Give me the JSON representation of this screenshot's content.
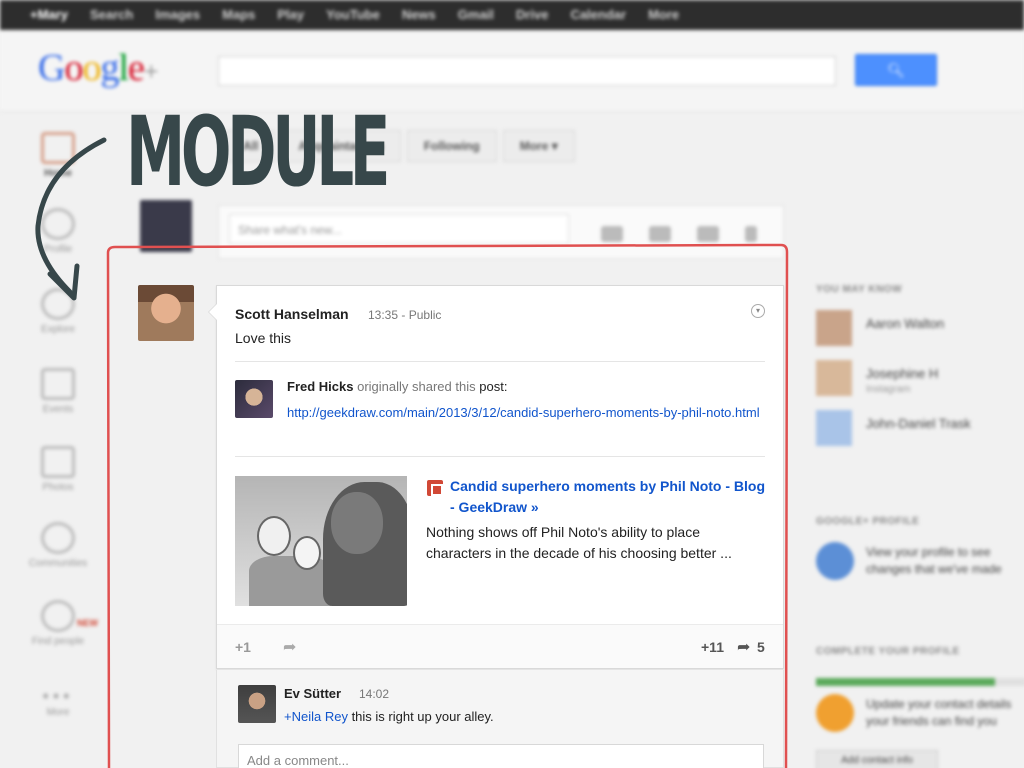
{
  "topbar": {
    "items": [
      "+Mary",
      "Search",
      "Images",
      "Maps",
      "Play",
      "YouTube",
      "News",
      "Gmail",
      "Drive",
      "Calendar",
      "More"
    ]
  },
  "header": {
    "logo_text": "Google",
    "logo_plus": "+",
    "search_icon": "search-icon"
  },
  "leftnav": {
    "items": [
      "Home",
      "Profile",
      "Explore",
      "Events",
      "Photos",
      "Communities",
      "Find people",
      "More"
    ],
    "new_tag": "NEW"
  },
  "filterbar": {
    "items": [
      "All",
      "Acquaintances",
      "Following",
      "More ▾"
    ]
  },
  "share": {
    "placeholder": "Share what's new..."
  },
  "post": {
    "author": "Scott Hanselman",
    "time": "13:35",
    "separator": "-",
    "visibility": "Public",
    "text": "Love this",
    "original_author": "Fred Hicks",
    "originally_shared": "originally shared this",
    "post_word": "post:",
    "link_url": "http://geekdraw.com/main/2013/3/12/candid-superhero-moments-by-phil-noto.html",
    "link_title": "Candid superhero moments by Phil Noto - Blog - GeekDraw »",
    "link_description": "Nothing shows off Phil Noto's ability to place characters in the decade of his choosing better ...",
    "plus_one": "+1",
    "plus_count": "+11",
    "share_count": "5"
  },
  "comment": {
    "author": "Ev Sütter",
    "time": "14:02",
    "mention": "+Neila Rey",
    "text": " this is right up your alley.",
    "input_placeholder": "Add a comment..."
  },
  "rightcol": {
    "you_may_know_heading": "YOU MAY KNOW",
    "people": [
      {
        "name": "Aaron Walton",
        "sub": ""
      },
      {
        "name": "Josephine H",
        "sub": "Instagram"
      },
      {
        "name": "John-Daniel Trask",
        "sub": ""
      }
    ],
    "profile_heading": "GOOGLE+ PROFILE",
    "profile_text": [
      "View your profile to see",
      "changes that we've made"
    ],
    "complete_heading": "COMPLETE YOUR PROFILE",
    "complete_progress": 0.85,
    "complete_text": [
      "Update your contact details",
      "your friends can find you"
    ],
    "contact_button": "Add contact info"
  },
  "annotation": {
    "label": "MODULE",
    "color": "#37474a",
    "outline_color": "#e05050"
  },
  "colors": {
    "link": "#1155cc",
    "search_button": "#4d90fe"
  }
}
